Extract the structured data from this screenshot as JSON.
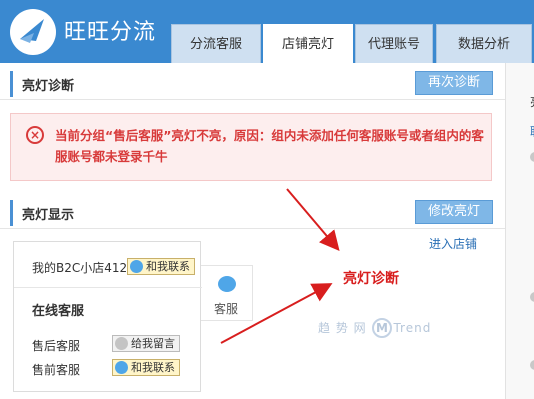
{
  "app": {
    "title": "旺旺分流"
  },
  "tabs": [
    {
      "label": "分流客服",
      "active": false
    },
    {
      "label": "店铺亮灯",
      "active": true
    },
    {
      "label": "代理账号",
      "active": false
    },
    {
      "label": "数据分析",
      "active": false
    }
  ],
  "diagnosis": {
    "title": "亮灯诊断",
    "button": "再次诊断",
    "error": "当前分组“售后客服”亮灯不亮，原因：组内未添加任何客服账号或者组内的客服账号都未登录千牛"
  },
  "display": {
    "title": "亮灯显示",
    "button": "修改亮灯",
    "enter_store": "进入店铺"
  },
  "card": {
    "store_name": "我的B2C小店412",
    "contact_label": "和我联系",
    "online_title": "在线客服",
    "rows": [
      {
        "label": "售后客服",
        "badge": "给我留言"
      },
      {
        "label": "售前客服",
        "badge": "和我联系"
      }
    ],
    "behind_label": "客服"
  },
  "annotation": {
    "text": "亮灯诊断",
    "color": "#d81e1e"
  },
  "watermark": {
    "left": "趋 势 网",
    "mark": "M",
    "right": "Trend"
  },
  "right_panel": {
    "chars": [
      "亮",
      "联"
    ]
  },
  "colors": {
    "header": "#3a89d0",
    "accent": "#4a90d4",
    "error": "#d83a3a",
    "link": "#2a6fb5"
  }
}
